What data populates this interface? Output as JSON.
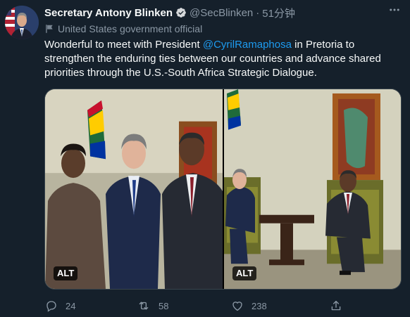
{
  "author": {
    "name": "Secretary Antony Blinken",
    "handle": "@SecBlinken",
    "separator": "·",
    "time": "51分钟",
    "label": "United States government official"
  },
  "tweet": {
    "text_before": "Wonderful to meet with President ",
    "mention": "@CyrilRamaphosa",
    "text_after": " in Pretoria to strengthen the enduring ties between our countries and advance shared priorities through the U.S.-South Africa Strategic Dialogue."
  },
  "media": [
    {
      "alt_badge": "ALT"
    },
    {
      "alt_badge": "ALT"
    }
  ],
  "stats": {
    "replies": "24",
    "retweets": "58",
    "likes": "238"
  },
  "icons": {
    "verified": "verified-badge-icon",
    "gov_flag": "flag-icon",
    "more": "more-dots-icon",
    "reply": "reply-icon",
    "retweet": "retweet-icon",
    "like": "heart-icon",
    "share": "share-icon"
  },
  "colors": {
    "background": "#15202b",
    "text": "#f7f9f9",
    "muted": "#8b98a5",
    "accent": "#1d9bf0"
  }
}
